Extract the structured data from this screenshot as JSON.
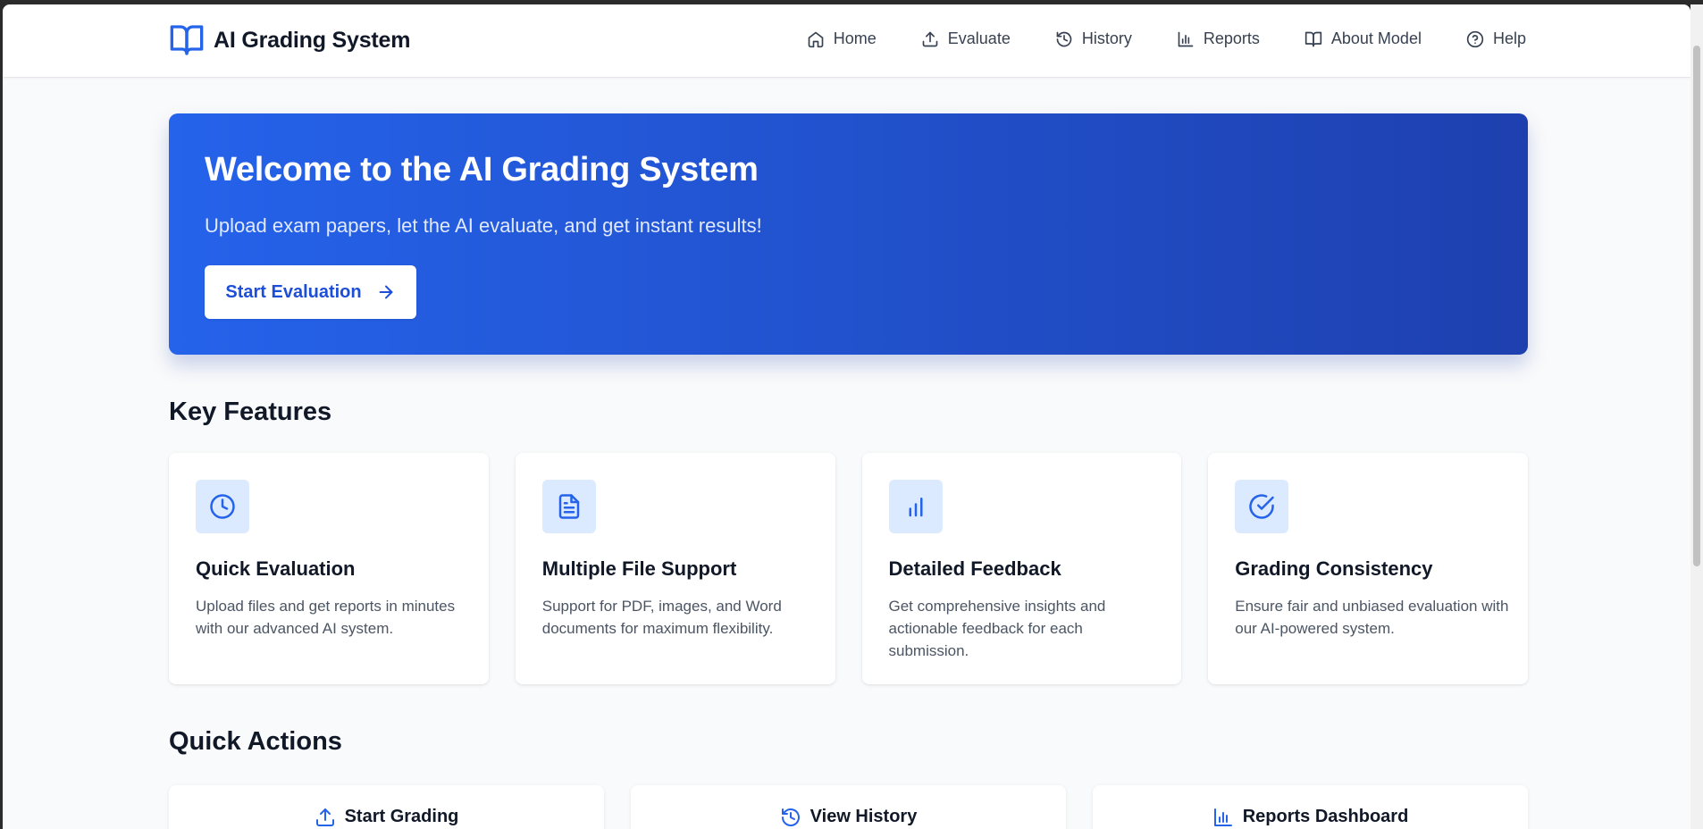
{
  "app": {
    "brand_name": "AI Grading System",
    "brand_icon": "book-open-icon",
    "accent_color": "#2563eb"
  },
  "nav": [
    {
      "label": "Home",
      "icon": "home-icon"
    },
    {
      "label": "Evaluate",
      "icon": "upload-icon"
    },
    {
      "label": "History",
      "icon": "history-icon"
    },
    {
      "label": "Reports",
      "icon": "bar-chart-icon"
    },
    {
      "label": "About Model",
      "icon": "book-open-icon"
    },
    {
      "label": "Help",
      "icon": "help-circle-icon"
    }
  ],
  "hero": {
    "title": "Welcome to the AI Grading System",
    "subtitle": "Upload exam papers, let the AI evaluate, and get instant results!",
    "button_label": "Start Evaluation",
    "button_icon": "arrow-right-icon",
    "gradient": [
      "#2563eb",
      "#1e40af"
    ]
  },
  "features_section": {
    "title": "Key Features",
    "items": [
      {
        "title": "Quick Evaluation",
        "description": "Upload files and get reports in minutes with our advanced AI system.",
        "icon": "clock-icon"
      },
      {
        "title": "Multiple File Support",
        "description": "Support for PDF, images, and Word documents for maximum flexibility.",
        "icon": "file-text-icon"
      },
      {
        "title": "Detailed Feedback",
        "description": "Get comprehensive insights and actionable feedback for each submission.",
        "icon": "bar-chart-icon"
      },
      {
        "title": "Grading Consistency",
        "description": "Ensure fair and unbiased evaluation with our AI-powered system.",
        "icon": "check-circle-icon"
      }
    ]
  },
  "actions_section": {
    "title": "Quick Actions",
    "items": [
      {
        "label": "Start Grading",
        "icon": "upload-icon"
      },
      {
        "label": "View History",
        "icon": "history-icon"
      },
      {
        "label": "Reports Dashboard",
        "icon": "bar-chart-icon"
      }
    ]
  }
}
